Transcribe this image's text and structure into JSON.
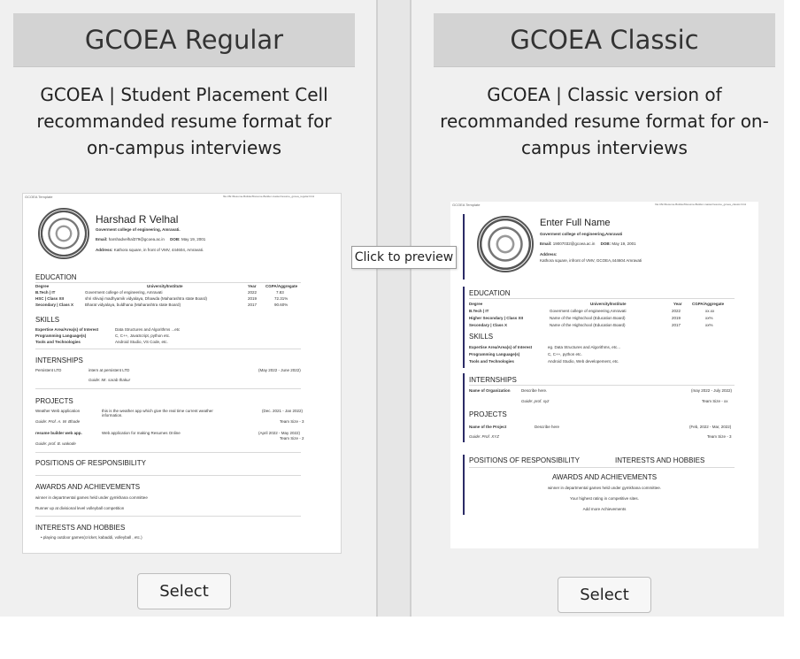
{
  "templates": [
    {
      "title": "GCOEA Regular",
      "description": "GCOEA | Student Placement Cell recommanded resume format for on-campus interviews",
      "select_label": "Select",
      "preview": {
        "header_left": "GCOEA Template",
        "header_right": "file:///E:/Resume-Builder/Resume-Builder-master/resume_gcoea_regular.html",
        "name": "Harshad R Velhal",
        "college": "Goverment college of engineering, Amravati.",
        "email_label": "Email:",
        "email": "harshadvelhal379@gcoea.ac.in",
        "dob_label": "DOB:",
        "dob": "May 19, 2001",
        "address_label": "Address:",
        "address": "Kathora square, in front of VMV, 444604, Amravati.",
        "education_title": "EDUCATION",
        "edu_headers": [
          "Degree",
          "University/Institute",
          "Year",
          "CGPA/Aggregate"
        ],
        "edu_rows": [
          [
            "B.Tech | IT",
            "Goverment college of engineering, Amravati",
            "2022",
            "7.83"
          ],
          [
            "HSC | Class XII",
            "shri shivaji madhyamik vidyalaya, Dhawda (Maharashtra state Board)",
            "2019",
            "72.31%"
          ],
          [
            "Secondary | Class X",
            "Bharat vidyalaya, buldhana (Maharashtra state Board)",
            "2017",
            "90.60%"
          ]
        ],
        "skills_title": "SKILLS",
        "skills": [
          [
            "Expertise Area/Area(s) of Interest",
            "Data Structures and Algorithms ...etc"
          ],
          [
            "Programming Language(s)",
            "C, C++, JavaScript, python etc."
          ],
          [
            "Tools and Technologies",
            "Android Studio, VS Code, etc."
          ]
        ],
        "internships_title": "INTERNSHIPS",
        "internship": [
          "Persistent LTD",
          "intern at persistent LTD",
          "(May 2022 - June 2022)"
        ],
        "internship_guide": "Guide: Mr. sarab thakur",
        "projects_title": "PROJECTS",
        "projects": [
          [
            "Weather Web application",
            "this is the weather app which give the real time current weather information.",
            "(Dec. 2021 - Jan 2022)",
            "Guide: Prof. A. W. Bhade",
            "Team Size - 3"
          ],
          [
            "resume builder web app.",
            "Web application for making Resumes Online",
            "(April 2022 - May 2022)",
            "Guide: prof. B. wakode",
            "Team Size - 2"
          ]
        ],
        "por_title": "POSITIONS OF RESPONSIBILITY",
        "awards_title": "AWARDS AND ACHIEVEMENTS",
        "awards": [
          "winner in departmental games held under gymkhana committee",
          "Runner up at divisional level volleyball competition"
        ],
        "interests_title": "INTERESTS AND HOBBIES",
        "interests": [
          "• playing outdoor games(cricket, kabaddi, volleyball , etc.)"
        ]
      }
    },
    {
      "title": "GCOEA Classic",
      "description": "GCOEA | Classic version of recommanded resume format for on-campus interviews",
      "select_label": "Select",
      "preview": {
        "header_left": "GCOEA Template",
        "header_right": "file:///E:/Resume-Builder/Resume-Builder-master/resume_gcoea_classic.html",
        "name": "Enter Full Name",
        "college": "Goverment college of engineering,Amravati",
        "email_label": "Email:",
        "email": "19007032@gcoea.ac.in",
        "dob_label": "DOB:",
        "dob": "May 19, 2001",
        "address_label": "Address:",
        "address": "Kathora square, infront of VMV, GCOEA,444604 Amravati",
        "education_title": "EDUCATION",
        "edu_headers": [
          "Degree",
          "University/Institute",
          "Year",
          "CGPA/Aggregate"
        ],
        "edu_rows": [
          [
            "B.Tech | IT",
            "Goverment college of engineering,Amravati",
            "2022",
            "xx.xx"
          ],
          [
            "Higher Secondary | Class XII",
            "Name of the Highschool (Education Board)",
            "2019",
            "xx%"
          ],
          [
            "Secondary | Class X",
            "Name of the Highschool (Education Board)",
            "2017",
            "xx%"
          ]
        ],
        "skills_title": "SKILLS",
        "skills": [
          [
            "Expertise Area/Area(s) of Interest",
            "eg. Data Structures and Algorithms, etc..."
          ],
          [
            "Programming Language(s)",
            "C, C++, python etc."
          ],
          [
            "Tools and Technologies",
            "Android Studio, Web developement, etc."
          ]
        ],
        "internships_title": "INTERNSHIPS",
        "internship": [
          "Name of Organization",
          "Describe here.",
          "(may 2022 - July 2022)"
        ],
        "internship_guide": "Guide: prof. xyz",
        "internship_team": "Team Size - xx",
        "projects_title": "PROJECTS",
        "project": [
          "Name of the Project",
          "Describe here",
          "(Feb, 2022 - Mar, 2022)"
        ],
        "project_guide": "Guide: Prof. XYZ",
        "project_team": "Team Size - 3",
        "por_title": "POSITIONS OF RESPONSIBILITY",
        "interests_title": "INTERESTS AND HOBBIES",
        "awards_title": "AWARDS AND ACHIEVEMENTS",
        "awards": [
          "winner in departmental games held under gymkhana committee.",
          "Your highest rating in competitive sites.",
          "Add more Achievements"
        ]
      }
    }
  ],
  "tooltip": "Click to preview"
}
